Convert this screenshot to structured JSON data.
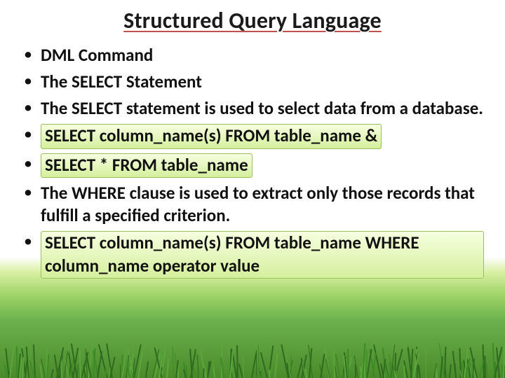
{
  "title": "Structured Query Language",
  "bullets": {
    "b1": "DML  Command",
    "b2": "The SELECT Statement",
    "b3_a": "The SELECT statement is used to ",
    "b3_b": "select data",
    "b3_c": " from a database.",
    "b4": "SELECT column_name(s) FROM table_name &",
    "b5": "SELECT * FROM table_name",
    "b6": "The WHERE clause is used to extract only those records that fulfill a specified criterion.",
    "b7": "SELECT column_name(s) FROM table_name WHERE column_name operator value"
  }
}
